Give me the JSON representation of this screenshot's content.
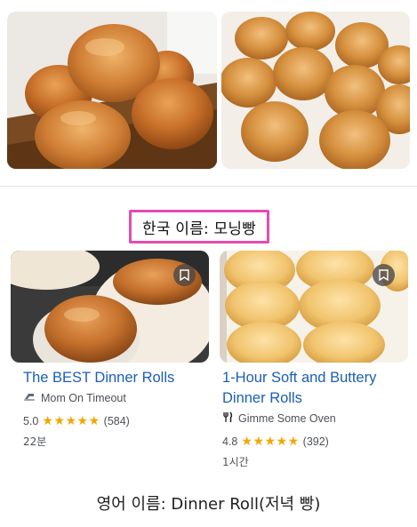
{
  "korean_name_label": "한국 이름: 모닝빵",
  "english_name_label": "영어 이름: Dinner Roll(저녁 빵)",
  "cards": [
    {
      "title_line1": "The BEST Dinner Rolls",
      "title_line2": "",
      "source": "Mom On Timeout",
      "source_icon": "mixer-icon",
      "rating": "5.0",
      "stars": "★★★★★",
      "review_count": "(584)",
      "time": "22분"
    },
    {
      "title_line1": "1-Hour Soft and Buttery",
      "title_line2": "Dinner Rolls",
      "source": "Gimme Some Oven",
      "source_icon": "fork-knife-icon",
      "rating": "4.8",
      "stars": "★★★★★",
      "review_count": "(392)",
      "time": "1시간"
    }
  ],
  "colors": {
    "link_blue": "#1a5fb4",
    "star_gold": "#f2a600",
    "highlight_pink": "#e54bb0"
  }
}
